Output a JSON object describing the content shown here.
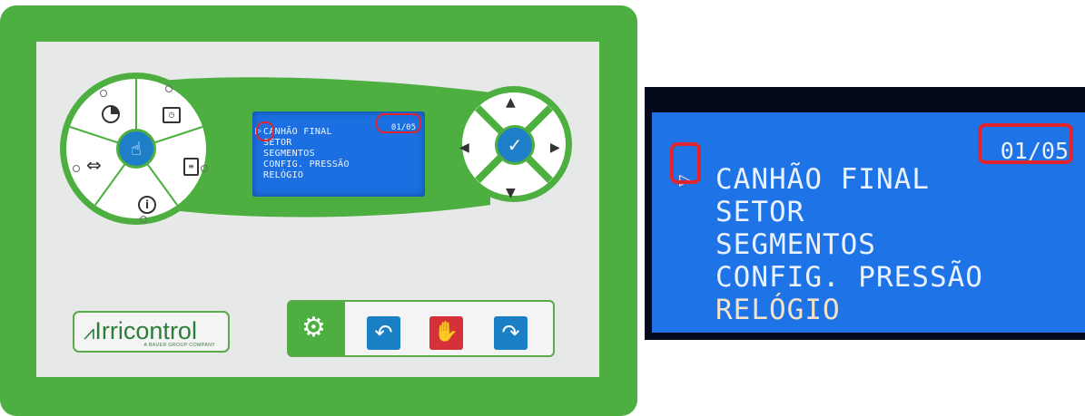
{
  "controller": {
    "brand": {
      "name": "Irricontrol",
      "tagline": "A BAUER GROUP COMPANY"
    },
    "lcd": {
      "counter": "01/05",
      "cursor_glyph": "▷",
      "menu": [
        "CANHÃO FINAL",
        "SETOR",
        "SEGMENTOS",
        "CONFIG. PRESSÃO",
        "RELÓGIO"
      ]
    },
    "colors": {
      "panel": "#4caf3f",
      "face": "#e7e8e8",
      "lcd": "#1b6fe0",
      "highlight": "#e0262c",
      "blue_button": "#1a7fc4",
      "red_button": "#d63139"
    },
    "left_wheel_icons": [
      "pie-chart-icon",
      "calendar-clock-icon",
      "clipboard-icon",
      "info-icon",
      "swap-arrows-icon",
      "touch-hand-icon"
    ],
    "right_pad_icons": [
      "arrow-up-icon",
      "arrow-down-icon",
      "arrow-left-icon",
      "arrow-right-icon",
      "check-icon"
    ],
    "button_bar_icons": [
      "gear-icon",
      "undo-arrow-icon",
      "stop-hand-icon",
      "redo-arrow-icon"
    ]
  },
  "zoomed_display": {
    "counter": "01/05",
    "cursor_glyph": "▷",
    "menu": [
      "CANHÃO FINAL",
      "SETOR",
      "SEGMENTOS",
      "CONFIG. PRESSÃO",
      "RELÓGIO"
    ]
  }
}
